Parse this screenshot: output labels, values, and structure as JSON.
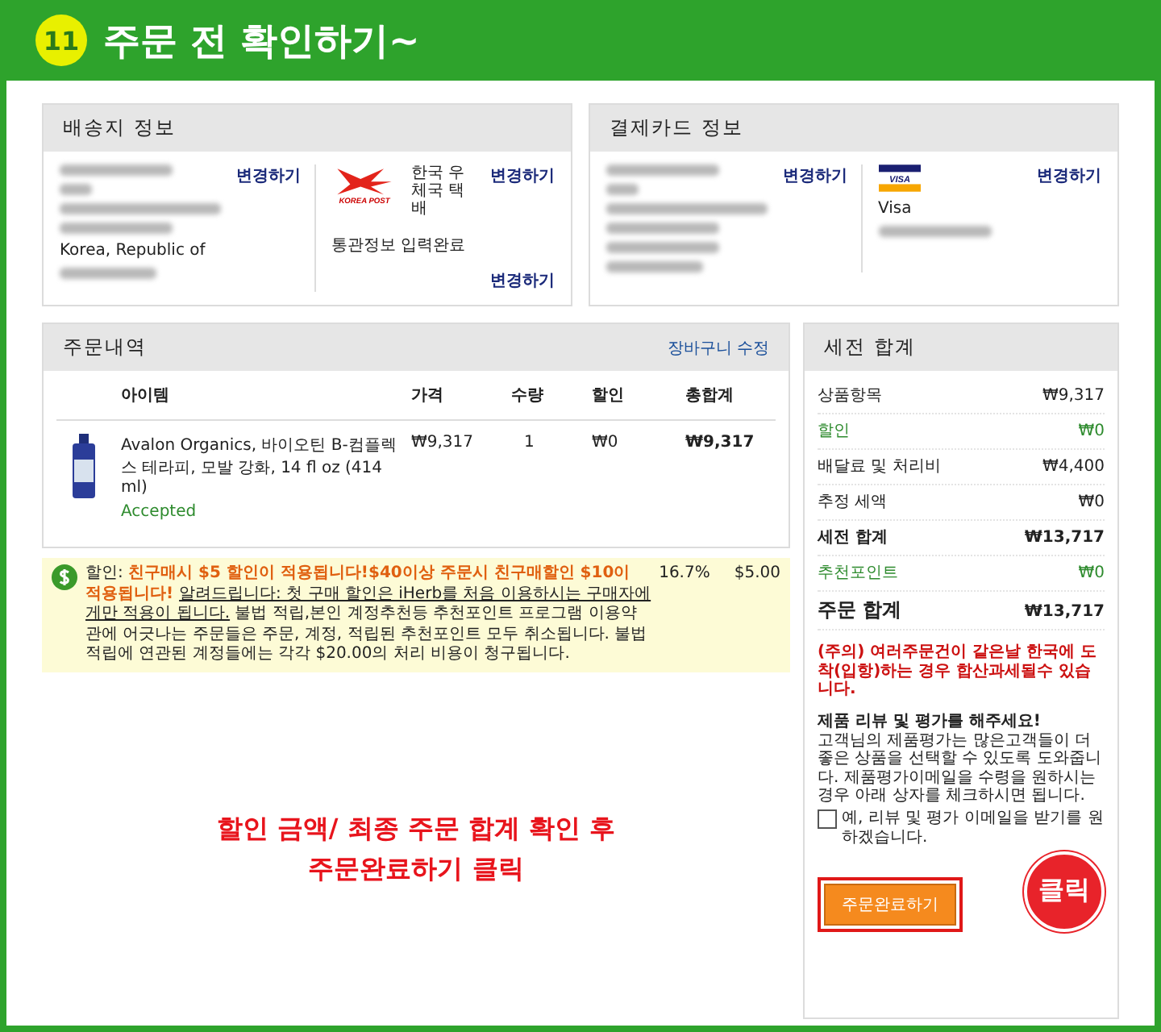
{
  "header": {
    "step": "11",
    "title": "주문 전 확인하기~"
  },
  "shipping": {
    "title": "배송지 정보",
    "country": "Korea, Republic of",
    "change": "변경하기",
    "carrier_logo": "KOREA POST",
    "carrier": "한국 우체국 택배",
    "customs": "통관정보 입력완료",
    "carrier_change_top": "변경하기",
    "carrier_change": "변경하기"
  },
  "payment": {
    "title": "결제카드 정보",
    "change": "변경하기",
    "card_logo": "VISA",
    "card": "Visa",
    "card_change": "변경하기"
  },
  "order": {
    "title": "주문내역",
    "edit_link": "장바구니 수정",
    "columns": [
      "아이템",
      "가격",
      "수량",
      "할인",
      "총합계"
    ],
    "items": [
      {
        "name": "Avalon Organics, 바이오틴 B-컴플렉스 테라피, 모발 강화, 14 fl oz (414 ml)",
        "status": "Accepted",
        "price": "₩9,317",
        "qty": "1",
        "discount": "₩0",
        "total": "₩9,317"
      }
    ]
  },
  "notice": {
    "segments": [
      {
        "kind": "plain",
        "text": "할인: "
      },
      {
        "kind": "highlight",
        "text": "친구매시 $5 할인이 적용됩니다!$40이상 주문시 친구매할인 $10이 적용됩니다! "
      },
      {
        "kind": "underline",
        "text": "알려드립니다: 첫 구매 할인은 iHerb를 처음 이용하시는 구매자에게만 적용이 됩니다."
      },
      {
        "kind": "plain",
        "text": " 불법 적립,본인 계정추천등 추천포인트 프로그램 이용약관에 어긋나는 주문들은 주문, 계정, 적립된 추천포인트 모두 취소됩니다. 불법적립에 연관된 계정들에는 각각 $20.00의 처리 비용이 청구됩니다."
      }
    ],
    "percent": "16.7%",
    "amount": "$5.00"
  },
  "caption": [
    "할인 금액/ 최종 주문 합계 확인 후",
    "주문완료하기 클릭"
  ],
  "summary": {
    "title": "세전 합계",
    "rows": [
      {
        "label": "상품항목",
        "value": "₩9,317",
        "kind": "normal"
      },
      {
        "label": "할인",
        "value": "₩0",
        "kind": "green"
      },
      {
        "label": "배달료 및 처리비",
        "value": "₩4,400",
        "kind": "normal"
      },
      {
        "label": "추정 세액",
        "value": "₩0",
        "kind": "normal"
      },
      {
        "label": "세전 합계",
        "value": "₩13,717",
        "kind": "bold"
      },
      {
        "label": "추천포인트",
        "value": "₩0",
        "kind": "green"
      },
      {
        "label": "주문 합계",
        "value": "₩13,717",
        "kind": "total"
      }
    ],
    "warning": "(주의) 여러주문건이 같은날 한국에 도착(입항)하는 경우 합산과세될수 있습니다.",
    "review_title": "제품 리뷰 및 평가를 해주세요!",
    "review_text": "고객님의 제품평가는 많은고객들이 더 좋은 상품을 선택할 수 있도록 도와줍니다. 제품평가이메일을 수령을 원하시는 경우 아래 상자를 체크하시면 됩니다.",
    "checkbox": {
      "label": "예, 리뷰 및 평가 이메일을 받기를 원하겠습니다.",
      "checked": false
    },
    "submit": "주문완료하기"
  },
  "callout": "클릭"
}
